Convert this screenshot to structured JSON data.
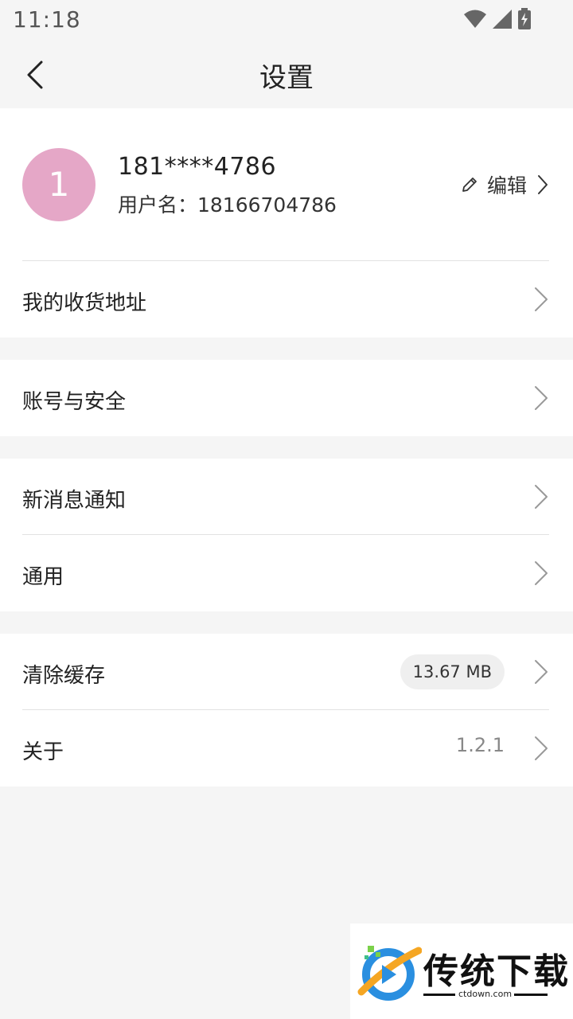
{
  "status_bar": {
    "time": "11:18"
  },
  "header": {
    "title": "设置"
  },
  "profile": {
    "avatar_text": "1",
    "avatar_color": "#e5a7c7",
    "phone": "181****4786",
    "username": "用户名：18166704786",
    "edit_label": "编辑"
  },
  "menu": {
    "address": "我的收货地址",
    "account_security": "账号与安全",
    "notifications": "新消息通知",
    "general": "通用",
    "clear_cache": "清除缓存",
    "cache_size": "13.67 MB",
    "about": "关于",
    "version": "1.2.1"
  },
  "watermark": {
    "name": "传统下载",
    "url": "ctdown.com"
  }
}
